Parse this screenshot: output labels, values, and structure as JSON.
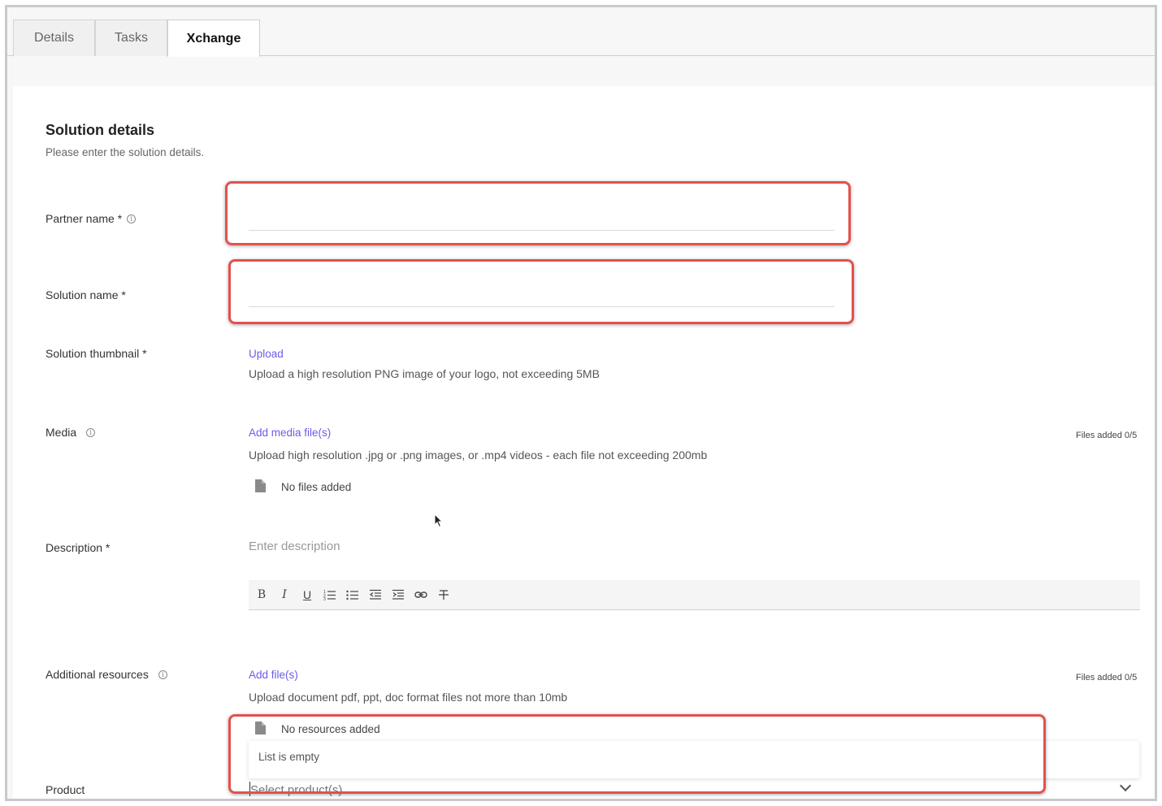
{
  "tabs": [
    {
      "label": "Details"
    },
    {
      "label": "Tasks"
    },
    {
      "label": "Xchange"
    }
  ],
  "section": {
    "title": "Solution details",
    "subtitle": "Please enter the solution details."
  },
  "fields": {
    "partner_name": {
      "label": "Partner name *",
      "value": ""
    },
    "solution_name": {
      "label": "Solution name *",
      "value": ""
    },
    "thumbnail": {
      "label": "Solution thumbnail *",
      "action": "Upload",
      "hint": "Upload a high resolution PNG image of your logo, not exceeding 5MB"
    },
    "media": {
      "label": "Media",
      "action": "Add media file(s)",
      "hint": "Upload high resolution .jpg or .png images, or .mp4 videos - each file not exceeding 200mb",
      "counter": "Files added 0/5",
      "empty": "No files added"
    },
    "description": {
      "label": "Description *",
      "placeholder": "Enter description"
    },
    "resources": {
      "label": "Additional resources",
      "action": "Add file(s)",
      "hint": "Upload document pdf, ppt, doc format files not more than 10mb",
      "counter": "Files added 0/5",
      "empty": "No resources added"
    },
    "product": {
      "label": "Product",
      "placeholder": "Select product(s)",
      "dropdown_message": "List is empty"
    }
  },
  "toolbar": {
    "bold": "B",
    "italic": "I",
    "underline": "U"
  }
}
